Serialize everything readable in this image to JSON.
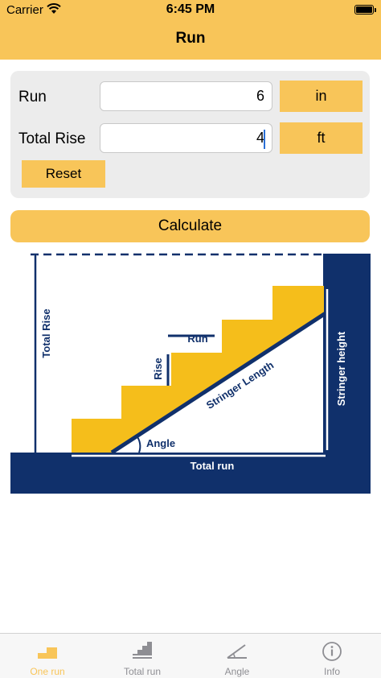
{
  "status_bar": {
    "carrier": "Carrier",
    "time": "6:45 PM"
  },
  "nav": {
    "title": "Run"
  },
  "form": {
    "run": {
      "label": "Run",
      "value": "6",
      "unit": "in"
    },
    "total_rise": {
      "label": "Total Rise",
      "value": "4",
      "unit": "ft"
    },
    "reset_label": "Reset"
  },
  "calculate_label": "Calculate",
  "diagram": {
    "labels": {
      "total_rise": "Total Rise",
      "run": "Run",
      "rise": "Rise",
      "stringer_length": "Stringer Length",
      "stringer_height": "Stringer height",
      "angle": "Angle",
      "total_run": "Total run"
    },
    "colors": {
      "navy": "#10306b",
      "yellow": "#f5be1b",
      "white": "#ffffff"
    }
  },
  "tabs": [
    {
      "label": "One run",
      "icon": "one-run-icon",
      "active": true
    },
    {
      "label": "Total run",
      "icon": "total-run-icon",
      "active": false
    },
    {
      "label": "Angle",
      "icon": "angle-icon",
      "active": false
    },
    {
      "label": "Info",
      "icon": "info-icon",
      "active": false
    }
  ],
  "colors": {
    "accent": "#f8c559",
    "card": "#ececec",
    "tab_inactive": "#8e8e93"
  }
}
